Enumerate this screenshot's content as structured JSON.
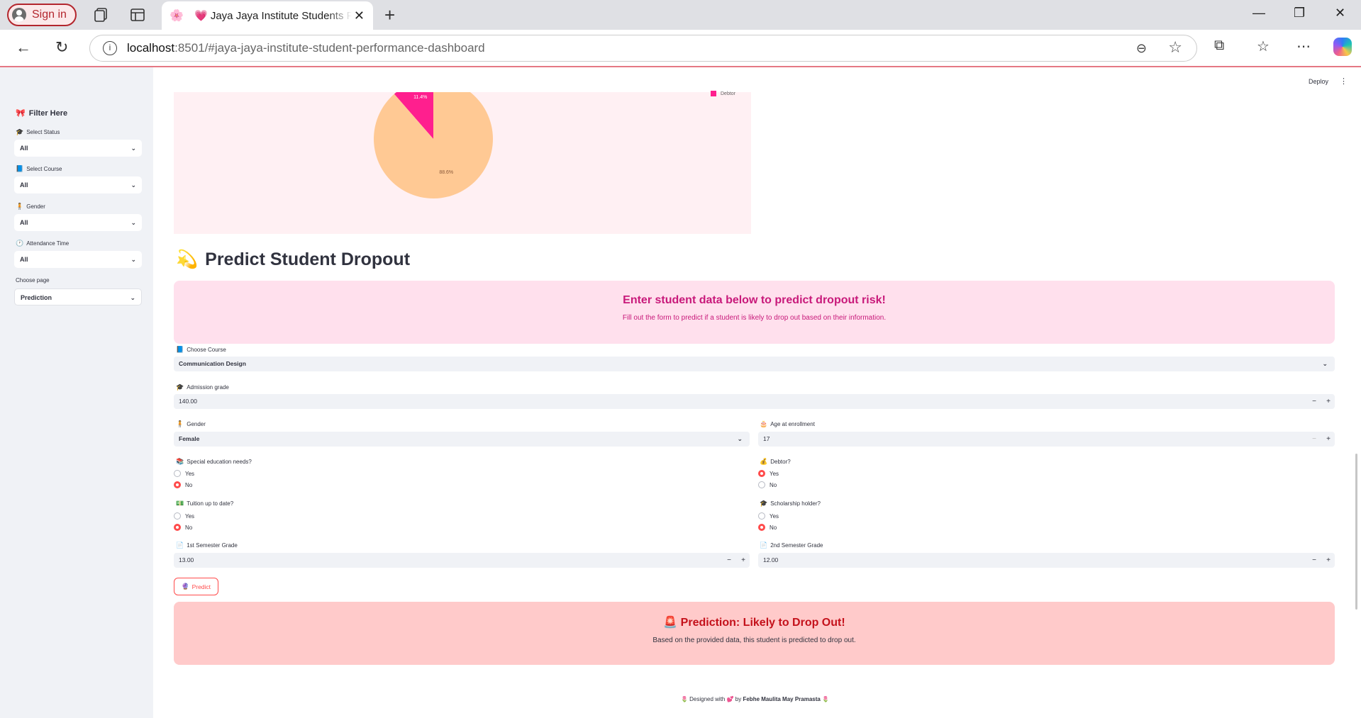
{
  "browser": {
    "signin_label": "Sign in",
    "tab_title": "💗 Jaya Jaya Institute Students Performance Dashboard",
    "tab_favicon": "🌸",
    "url_host": "localhost",
    "url_rest": ":8501/#jaya-jaya-institute-student-performance-dashboard"
  },
  "sidebar": {
    "title": "Filter Here",
    "title_icon": "🎀",
    "filters": [
      {
        "icon": "🎓",
        "label": "Select Status",
        "value": "All"
      },
      {
        "icon": "📘",
        "label": "Select Course",
        "value": "All"
      },
      {
        "icon": "🧍",
        "label": "Gender",
        "value": "All"
      },
      {
        "icon": "🕐",
        "label": "Attendance Time",
        "value": "All"
      },
      {
        "icon": "",
        "label": "Choose page",
        "value": "Prediction"
      }
    ]
  },
  "header": {
    "deploy_label": "Deploy"
  },
  "chart_data": {
    "type": "pie",
    "labels": [
      "Debtor",
      ""
    ],
    "values": [
      11.4,
      88.6
    ],
    "value_labels": [
      "11.4%",
      "88.6%"
    ],
    "colors": [
      "#ff1f8e",
      "#ffc994"
    ],
    "legend": [
      "Debtor"
    ]
  },
  "section": {
    "icon": "💫",
    "title": "Predict Student Dropout"
  },
  "info_banner": {
    "title": "Enter student data below to predict dropout risk!",
    "subtitle": "Fill out the form to predict if a student is likely to drop out based on their information."
  },
  "form": {
    "course": {
      "icon": "📘",
      "label": "Choose Course",
      "value": "Communication Design"
    },
    "admission": {
      "icon": "🎓",
      "label": "Admission grade",
      "value": "140.00"
    },
    "gender": {
      "icon": "🧍",
      "label": "Gender",
      "value": "Female"
    },
    "age": {
      "icon": "🎂",
      "label": "Age at enrollment",
      "value": "17"
    },
    "special_needs": {
      "icon": "📚",
      "label": "Special education needs?",
      "options": [
        "Yes",
        "No"
      ],
      "selected": "No"
    },
    "debtor": {
      "icon": "💰",
      "label": "Debtor?",
      "options": [
        "Yes",
        "No"
      ],
      "selected": "Yes"
    },
    "tuition": {
      "icon": "💵",
      "label": "Tuition up to date?",
      "options": [
        "Yes",
        "No"
      ],
      "selected": "No"
    },
    "scholarship": {
      "icon": "🎓",
      "label": "Scholarship holder?",
      "options": [
        "Yes",
        "No"
      ],
      "selected": "No"
    },
    "sem1": {
      "icon": "📄",
      "label": "1st Semester Grade",
      "value": "13.00"
    },
    "sem2": {
      "icon": "📄",
      "label": "2nd Semester Grade",
      "value": "12.00"
    },
    "predict_label": "Predict",
    "predict_icon": "🔮"
  },
  "result_banner": {
    "icon": "🚨",
    "title": "Prediction: Likely to Drop Out!",
    "subtitle": "Based on the provided data, this student is predicted to drop out."
  },
  "footer": {
    "prefix": "🌷 Designed with 💕 by",
    "author": "Febhe Maulita May Pramasta",
    "suffix": "🌷"
  }
}
